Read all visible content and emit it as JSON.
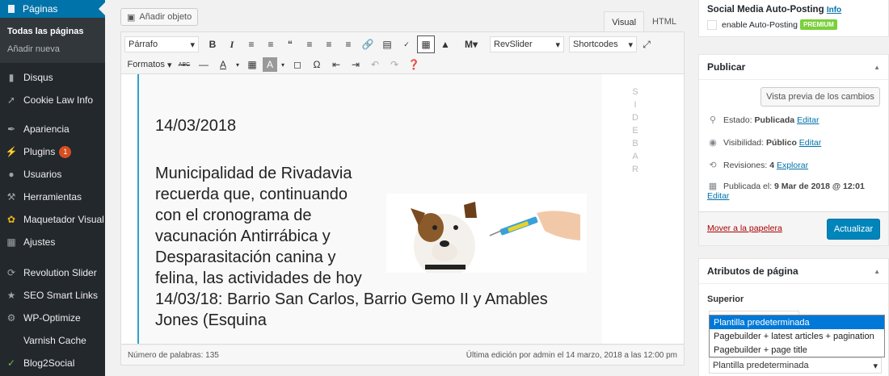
{
  "sidebar": {
    "current": "Páginas",
    "sub": [
      "Todas las páginas",
      "Añadir nueva"
    ],
    "items": [
      {
        "label": "Disqus",
        "icon": "comment-icon"
      },
      {
        "label": "Cookie Law Info",
        "icon": "pin-icon"
      },
      {
        "label": "Apariencia",
        "icon": "brush-icon"
      },
      {
        "label": "Plugins",
        "icon": "plugin-icon",
        "badge": "1"
      },
      {
        "label": "Usuarios",
        "icon": "user-icon"
      },
      {
        "label": "Herramientas",
        "icon": "wrench-icon"
      },
      {
        "label": "Maquetador Visual",
        "icon": "visual-icon"
      },
      {
        "label": "Ajustes",
        "icon": "settings-icon"
      },
      {
        "label": "Revolution Slider",
        "icon": "refresh-icon"
      },
      {
        "label": "SEO Smart Links",
        "icon": "link-icon"
      },
      {
        "label": "WP-Optimize",
        "icon": "optimize-icon"
      },
      {
        "label": "Varnish Cache",
        "icon": ""
      },
      {
        "label": "Blog2Social",
        "icon": "share-icon"
      }
    ]
  },
  "editor": {
    "add_media": "Añadir objeto",
    "tab_visual": "Visual",
    "tab_html": "HTML",
    "format_select": "Párrafo",
    "revslider_select": "RevSlider",
    "shortcodes_select": "Shortcodes",
    "formats_menu": "Formatos",
    "date": "14/03/2018",
    "body_text": "Municipalidad de Rivadavia recuerda que, continuando con el cronograma de vacunación Antirrábica y Desparasitación canina y felina, las actividades de hoy 14/03/18: Barrio San Carlos, Barrio Gemo II y Amables Jones (Esquina",
    "sidebar_label": "SIDEBAR",
    "word_count": "Número de palabras: 135",
    "last_edit": "Última edición por admin el 14 marzo, 2018 a las 12:00 pm"
  },
  "social": {
    "title": "Social Media Auto-Posting",
    "info": "Info",
    "enable_label": "enable Auto-Posting",
    "premium": "PREMIUM"
  },
  "publish": {
    "title": "Publicar",
    "preview": "Vista previa de los cambios",
    "estado_label": "Estado:",
    "estado": "Publicada",
    "visibilidad_label": "Visibilidad:",
    "visibilidad": "Público",
    "revisiones_label": "Revisiones:",
    "revisiones": "4",
    "explorar": "Explorar",
    "publicada_label": "Publicada el:",
    "publicada": "9 Mar de 2018 @ 12:01",
    "editar": "Editar",
    "trash": "Mover a la papelera",
    "update": "Actualizar"
  },
  "attributes": {
    "title": "Atributos de página",
    "superior": "Superior",
    "template_options": [
      "Plantilla predeterminada",
      "Pagebuilder + latest articles + pagination",
      "Pagebuilder + page title"
    ],
    "template_selected": "Plantilla predeterminada"
  }
}
